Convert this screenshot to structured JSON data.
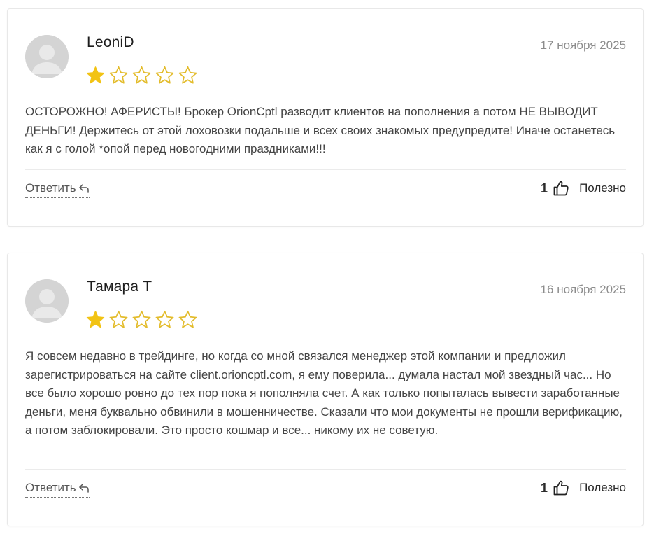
{
  "colors": {
    "star_filled": "#F2C314",
    "star_empty_stroke": "#E3BC2C"
  },
  "reviews": [
    {
      "author": "LeoniD",
      "date": "17 ноября 2025",
      "rating": 1,
      "max_rating": 5,
      "text": "ОСТОРОЖНО! АФЕРИСТЫ! Брокер OrionCptl разводит клиентов на пополнения а потом НЕ ВЫВОДИТ ДЕНЬГИ! Держитесь от этой лоховозки подальше и всех своих знакомых предупредите! Иначе останетесь как я с голой *опой перед новогодними праздниками!!!",
      "reply_label": "Ответить",
      "likes": "1",
      "helpful_label": "Полезно"
    },
    {
      "author": "Тамара Т",
      "date": "16 ноября 2025",
      "rating": 1,
      "max_rating": 5,
      "text": "Я совсем недавно в трейдинге, но когда со мной связался менеджер этой компании и предложил зарегистрироваться на сайте client.orioncptl.com, я ему поверила... думала настал мой звездный час... Но все было хорошо ровно до тех пор пока я пополняла счет. А как только попыталась вывести заработанные деньги, меня буквально обвинили в мошенничестве. Сказали что мои документы не прошли верификацию, а потом заблокировали. Это просто кошмар и все... никому их не советую.",
      "reply_label": "Ответить",
      "likes": "1",
      "helpful_label": "Полезно"
    }
  ]
}
